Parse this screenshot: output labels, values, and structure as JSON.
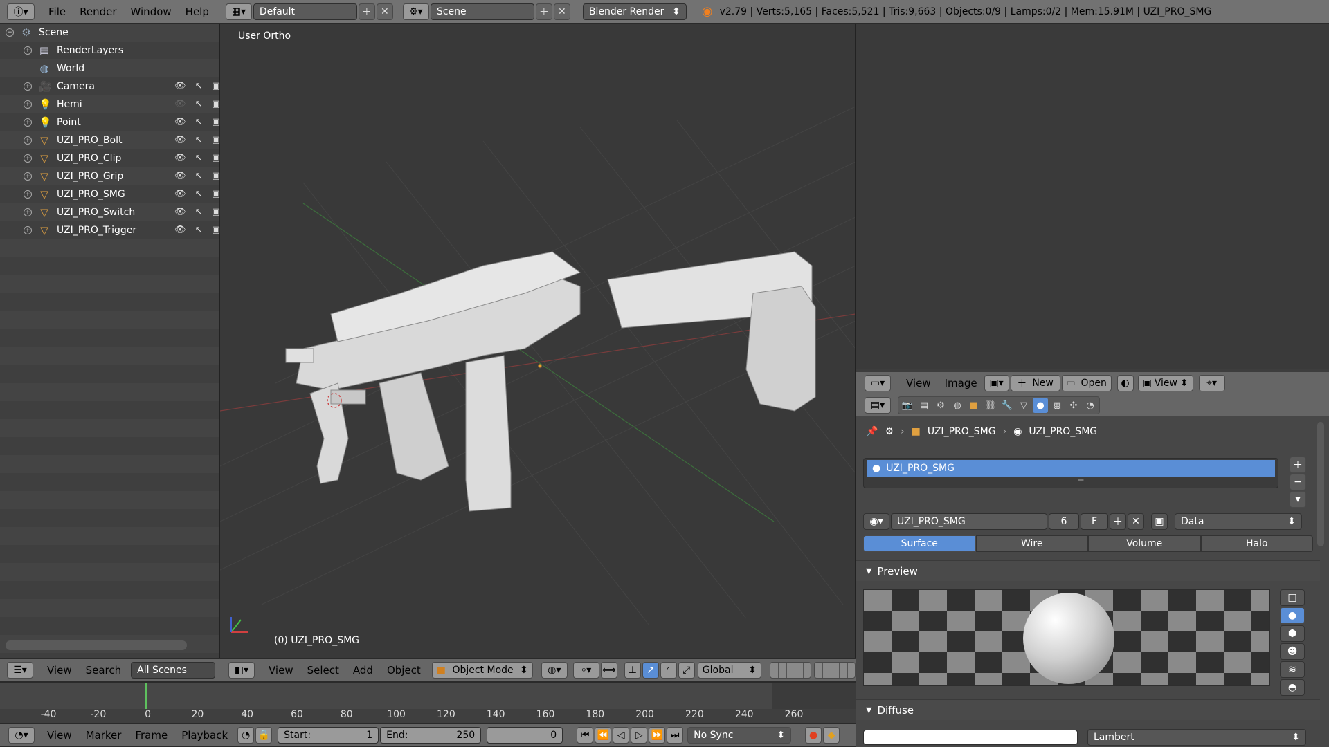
{
  "topbar": {
    "menus": [
      "File",
      "Render",
      "Window",
      "Help"
    ],
    "layout": "Default",
    "scene": "Scene",
    "engine": "Blender Render",
    "stats": "v2.79 | Verts:5,165 | Faces:5,521 | Tris:9,663 | Objects:0/9 | Lamps:0/2 | Mem:15.91M | UZI_PRO_SMG"
  },
  "outliner": {
    "items": [
      {
        "label": "Scene",
        "icon": "scene-icon"
      },
      {
        "label": "RenderLayers",
        "icon": "renderlayers-icon"
      },
      {
        "label": "World",
        "icon": "world-icon"
      },
      {
        "label": "Camera",
        "icon": "camera-icon"
      },
      {
        "label": "Hemi",
        "icon": "lamp-icon"
      },
      {
        "label": "Point",
        "icon": "lamp-icon"
      },
      {
        "label": "UZI_PRO_Bolt",
        "icon": "mesh-icon"
      },
      {
        "label": "UZI_PRO_Clip",
        "icon": "mesh-icon"
      },
      {
        "label": "UZI_PRO_Grip",
        "icon": "mesh-icon"
      },
      {
        "label": "UZI_PRO_SMG",
        "icon": "mesh-icon"
      },
      {
        "label": "UZI_PRO_Switch",
        "icon": "mesh-icon"
      },
      {
        "label": "UZI_PRO_Trigger",
        "icon": "mesh-icon"
      }
    ],
    "footer": {
      "view": "View",
      "search": "Search",
      "filter": "All Scenes"
    }
  },
  "viewport": {
    "view_name": "User Ortho",
    "object_label": "(0) UZI_PRO_SMG",
    "header": {
      "view": "View",
      "select": "Select",
      "add": "Add",
      "object": "Object",
      "mode": "Object Mode",
      "orientation": "Global"
    }
  },
  "timeline": {
    "ticks": [
      "-40",
      "-20",
      "0",
      "20",
      "40",
      "60",
      "80",
      "100",
      "120",
      "140",
      "160",
      "180",
      "200",
      "220",
      "240",
      "260"
    ],
    "footer": {
      "view": "View",
      "marker": "Marker",
      "frame": "Frame",
      "playback": "Playback",
      "start_label": "Start:",
      "start": "1",
      "end_label": "End:",
      "end": "250",
      "current": "0",
      "sync": "No Sync"
    }
  },
  "image_editor": {
    "view": "View",
    "image": "Image",
    "new": "New",
    "open": "Open",
    "view2": "View"
  },
  "properties": {
    "breadcrumb": [
      "UZI_PRO_SMG",
      "UZI_PRO_SMG"
    ],
    "material_slot": "UZI_PRO_SMG",
    "material_name": "UZI_PRO_SMG",
    "users": "6",
    "fake": "F",
    "link": "Data",
    "tabs": [
      "Surface",
      "Wire",
      "Volume",
      "Halo"
    ],
    "preview_label": "Preview",
    "diffuse_label": "Diffuse",
    "diffuse_shader": "Lambert"
  }
}
